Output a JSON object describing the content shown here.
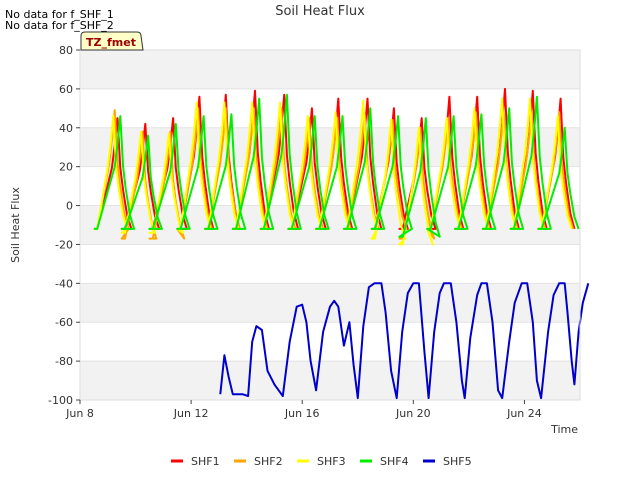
{
  "notes": [
    "No data for f_SHF_1",
    "No data for f_SHF_2"
  ],
  "tag_box": {
    "label": "TZ_fmet",
    "fill": "#ffffc8",
    "text_color": "#990000"
  },
  "chart_data": {
    "type": "line",
    "title": "Soil Heat Flux",
    "xlabel": "Time",
    "ylabel": "Soil Heat Flux",
    "x_unit": "days since Jun 8",
    "xlim": [
      0,
      18
    ],
    "ylim": [
      -100,
      80
    ],
    "x_ticks": [
      {
        "value": 0,
        "label": "Jun 8"
      },
      {
        "value": 4,
        "label": "Jun 12"
      },
      {
        "value": 8,
        "label": "Jun 16"
      },
      {
        "value": 12,
        "label": "Jun 20"
      },
      {
        "value": 16,
        "label": "Jun 24"
      }
    ],
    "y_ticks": [
      -100,
      -80,
      -60,
      -40,
      -20,
      0,
      20,
      40,
      60,
      80
    ],
    "band_color": "#f2f2f2",
    "legend_position": "bottom",
    "series": [
      {
        "name": "SHF1",
        "color": "#ff0000",
        "peaks": [
          [
            0.5,
            -12,
            1.35,
            45
          ],
          [
            1.5,
            -12,
            2.35,
            42
          ],
          [
            2.5,
            -12,
            3.35,
            45
          ],
          [
            3.5,
            -12,
            4.3,
            56
          ],
          [
            4.5,
            -12,
            5.25,
            57
          ],
          [
            5.5,
            -12,
            6.3,
            59
          ],
          [
            6.5,
            -12,
            7.35,
            57
          ],
          [
            7.5,
            -12,
            8.35,
            50
          ],
          [
            8.5,
            -12,
            9.3,
            55
          ],
          [
            9.5,
            -12,
            10.35,
            55
          ],
          [
            10.5,
            -12,
            11.3,
            50
          ],
          [
            11.5,
            -12,
            12.3,
            45
          ],
          [
            12.5,
            -12,
            13.3,
            56
          ],
          [
            13.5,
            -12,
            14.3,
            56
          ],
          [
            14.5,
            -12,
            15.3,
            60
          ],
          [
            15.5,
            -12,
            16.3,
            59
          ],
          [
            16.5,
            -12,
            17.3,
            55
          ]
        ]
      },
      {
        "name": "SHF2",
        "color": "#ffa500",
        "peaks": [
          [
            0.5,
            -12,
            1.25,
            49
          ],
          [
            1.5,
            -17,
            2.25,
            38
          ],
          [
            2.5,
            -17,
            3.25,
            38
          ],
          [
            3.5,
            -12,
            4.25,
            50
          ],
          [
            4.5,
            -12,
            5.25,
            50
          ],
          [
            5.5,
            -12,
            6.25,
            50
          ],
          [
            6.5,
            -12,
            7.25,
            50
          ],
          [
            7.5,
            -12,
            8.25,
            45
          ],
          [
            8.5,
            -12,
            9.25,
            45
          ],
          [
            9.5,
            -12,
            10.25,
            47
          ],
          [
            10.5,
            -12,
            11.25,
            44
          ],
          [
            11.5,
            -17,
            12.25,
            40
          ],
          [
            12.5,
            -12,
            13.25,
            45
          ],
          [
            13.5,
            -12,
            14.25,
            48
          ],
          [
            14.5,
            -12,
            15.25,
            48
          ],
          [
            15.5,
            -12,
            16.25,
            48
          ],
          [
            16.5,
            -12,
            17.25,
            48
          ]
        ]
      },
      {
        "name": "SHF3",
        "color": "#ffff00",
        "peaks": [
          [
            0.5,
            -12,
            1.2,
            46
          ],
          [
            1.5,
            -14,
            2.2,
            38
          ],
          [
            2.5,
            -14,
            3.2,
            37
          ],
          [
            3.5,
            -12,
            4.2,
            53
          ],
          [
            4.5,
            -12,
            5.2,
            53
          ],
          [
            5.5,
            -12,
            6.2,
            53
          ],
          [
            6.5,
            -12,
            7.2,
            53
          ],
          [
            7.5,
            -12,
            8.2,
            46
          ],
          [
            8.5,
            -12,
            9.2,
            48
          ],
          [
            9.5,
            -12,
            10.2,
            54
          ],
          [
            10.5,
            -17,
            11.2,
            44
          ],
          [
            11.5,
            -20,
            12.2,
            40
          ],
          [
            12.5,
            -12,
            13.2,
            45
          ],
          [
            13.5,
            -12,
            14.2,
            50
          ],
          [
            14.5,
            -12,
            15.2,
            55
          ],
          [
            15.5,
            -12,
            16.2,
            55
          ],
          [
            16.5,
            -12,
            17.2,
            46
          ]
        ]
      },
      {
        "name": "SHF4",
        "color": "#00ee00",
        "peaks": [
          [
            0.5,
            -12,
            1.45,
            46
          ],
          [
            1.5,
            -12,
            2.45,
            36
          ],
          [
            2.5,
            -12,
            3.45,
            42
          ],
          [
            3.5,
            -12,
            4.45,
            46
          ],
          [
            4.5,
            -12,
            5.45,
            47
          ],
          [
            5.5,
            -12,
            6.45,
            55
          ],
          [
            6.5,
            -12,
            7.45,
            57
          ],
          [
            7.5,
            -12,
            8.45,
            46
          ],
          [
            8.5,
            -12,
            9.45,
            46
          ],
          [
            9.5,
            -12,
            10.45,
            50
          ],
          [
            10.5,
            -12,
            11.45,
            46
          ],
          [
            11.5,
            -16,
            12.45,
            45
          ],
          [
            12.5,
            -12,
            13.45,
            46
          ],
          [
            13.5,
            -12,
            14.45,
            47
          ],
          [
            14.5,
            -12,
            15.45,
            50
          ],
          [
            15.5,
            -12,
            16.45,
            56
          ],
          [
            16.5,
            -12,
            17.45,
            40
          ]
        ]
      },
      {
        "name": "SHF5",
        "color": "#0000cc",
        "points": [
          [
            5.05,
            -97
          ],
          [
            5.2,
            -77
          ],
          [
            5.35,
            -88
          ],
          [
            5.5,
            -97
          ],
          [
            5.85,
            -97
          ],
          [
            6.05,
            -98
          ],
          [
            6.2,
            -70
          ],
          [
            6.35,
            -62
          ],
          [
            6.55,
            -64
          ],
          [
            6.75,
            -85
          ],
          [
            7.0,
            -92
          ],
          [
            7.3,
            -98
          ],
          [
            7.55,
            -70
          ],
          [
            7.8,
            -52
          ],
          [
            8.0,
            -51
          ],
          [
            8.15,
            -60
          ],
          [
            8.3,
            -80
          ],
          [
            8.5,
            -95
          ],
          [
            8.75,
            -65
          ],
          [
            9.0,
            -52
          ],
          [
            9.15,
            -49
          ],
          [
            9.3,
            -52
          ],
          [
            9.5,
            -72
          ],
          [
            9.7,
            -60
          ],
          [
            9.85,
            -82
          ],
          [
            10.0,
            -99
          ],
          [
            10.2,
            -62
          ],
          [
            10.4,
            -42
          ],
          [
            10.6,
            -40
          ],
          [
            10.85,
            -40
          ],
          [
            11.0,
            -55
          ],
          [
            11.2,
            -85
          ],
          [
            11.4,
            -99
          ],
          [
            11.6,
            -65
          ],
          [
            11.8,
            -45
          ],
          [
            12.0,
            -40
          ],
          [
            12.2,
            -40
          ],
          [
            12.4,
            -75
          ],
          [
            12.55,
            -99
          ],
          [
            12.75,
            -65
          ],
          [
            12.95,
            -45
          ],
          [
            13.1,
            -40
          ],
          [
            13.35,
            -40
          ],
          [
            13.55,
            -60
          ],
          [
            13.75,
            -90
          ],
          [
            13.85,
            -99
          ],
          [
            14.05,
            -68
          ],
          [
            14.3,
            -46
          ],
          [
            14.45,
            -40
          ],
          [
            14.65,
            -40
          ],
          [
            14.85,
            -60
          ],
          [
            15.05,
            -95
          ],
          [
            15.2,
            -99
          ],
          [
            15.45,
            -70
          ],
          [
            15.65,
            -50
          ],
          [
            15.9,
            -40
          ],
          [
            16.1,
            -40
          ],
          [
            16.3,
            -60
          ],
          [
            16.45,
            -90
          ],
          [
            16.6,
            -99
          ],
          [
            16.85,
            -65
          ],
          [
            17.05,
            -46
          ],
          [
            17.25,
            -40
          ],
          [
            17.45,
            -40
          ],
          [
            17.55,
            -55
          ],
          [
            17.7,
            -80
          ],
          [
            17.8,
            -92
          ],
          [
            17.95,
            -65
          ],
          [
            18.1,
            -50
          ],
          [
            18.3,
            -40
          ]
        ]
      }
    ]
  }
}
